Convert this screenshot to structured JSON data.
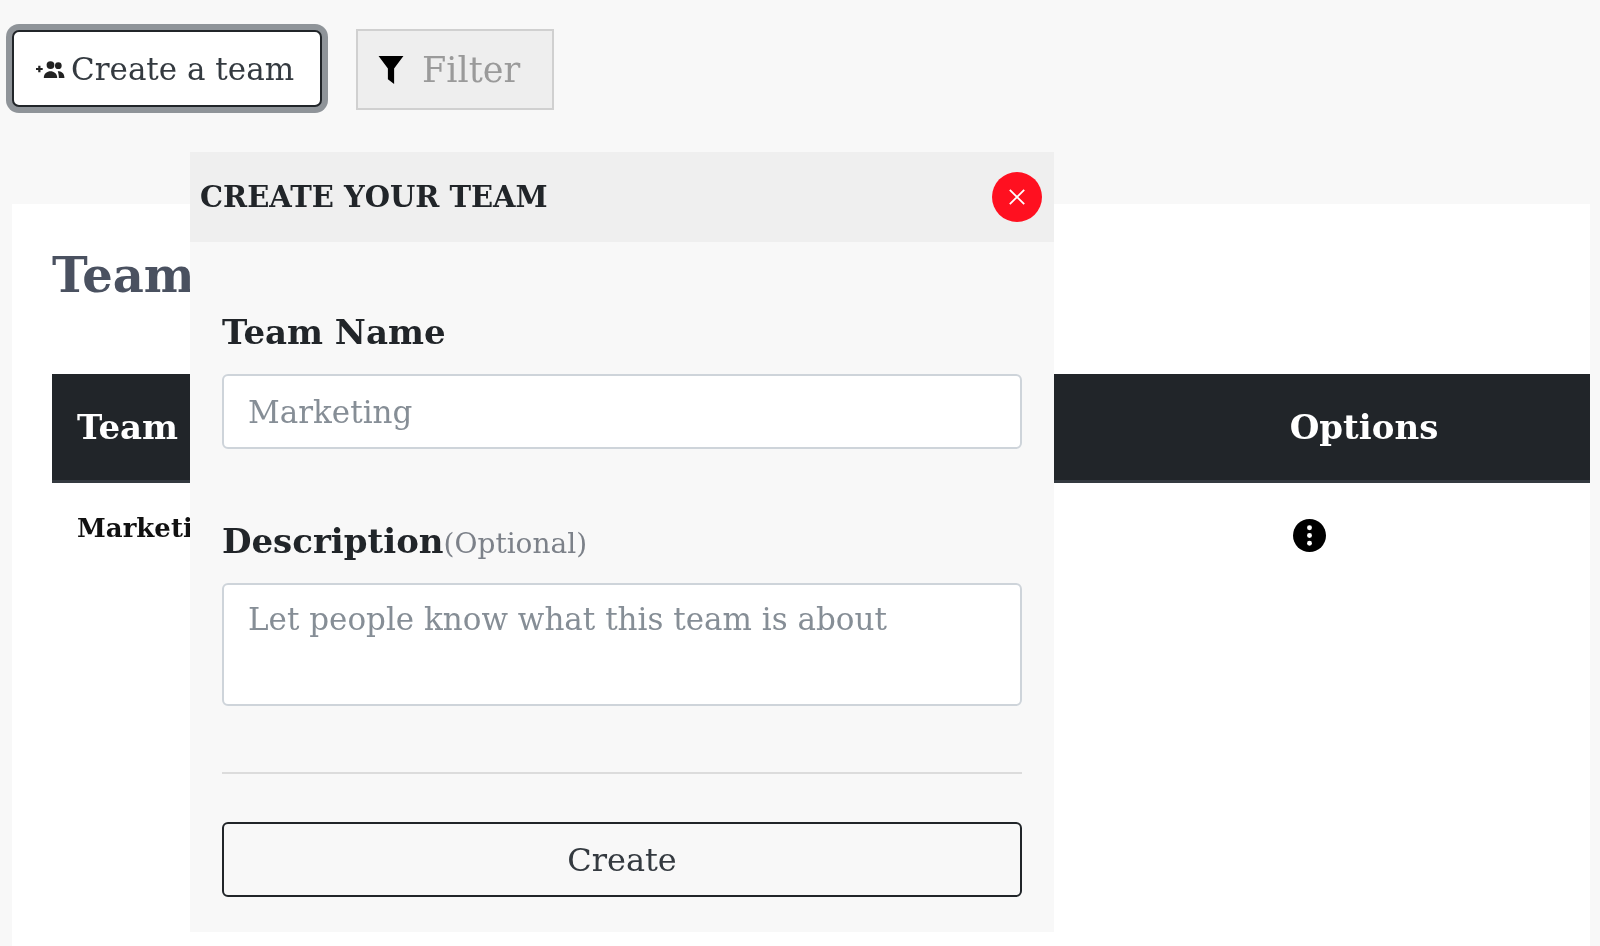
{
  "toolbar": {
    "create_button": "Create a team",
    "filter_button": "Filter"
  },
  "page": {
    "heading": "Team"
  },
  "table": {
    "columns": [
      "Team",
      "Options"
    ],
    "rows": [
      {
        "name": "Marketi"
      }
    ]
  },
  "modal": {
    "title": "CREATE YOUR TEAM",
    "fields": [
      {
        "label": "Team Name",
        "placeholder": "Marketing",
        "kind": "input"
      },
      {
        "label": "Description",
        "hint": "(Optional)",
        "placeholder": "Let people know what this team is about",
        "kind": "textarea"
      }
    ],
    "submit": "Create"
  }
}
